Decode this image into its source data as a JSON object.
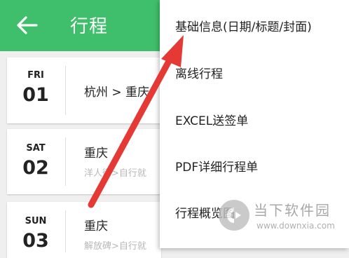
{
  "appbar": {
    "title": "行程",
    "back_icon": "arrow-left-icon",
    "color": "#3fbf6b"
  },
  "days": [
    {
      "dow": "FRI",
      "day": "01",
      "city": "杭州 > 重庆",
      "route": ""
    },
    {
      "dow": "SAT",
      "day": "02",
      "city": "重庆",
      "route": "洋人街>自行就"
    },
    {
      "dow": "SUN",
      "day": "03",
      "city": "重庆",
      "route": "解放碑>自行就"
    }
  ],
  "menu": {
    "items": [
      "基础信息(日期/标题/封面)",
      "离线行程",
      "EXCEL送签单",
      "PDF详细行程单",
      "行程概览图"
    ]
  },
  "watermark": {
    "brand": "当下软件园",
    "url": "www.downxia.com"
  },
  "annotation": {
    "arrow_color": "#e53935"
  }
}
